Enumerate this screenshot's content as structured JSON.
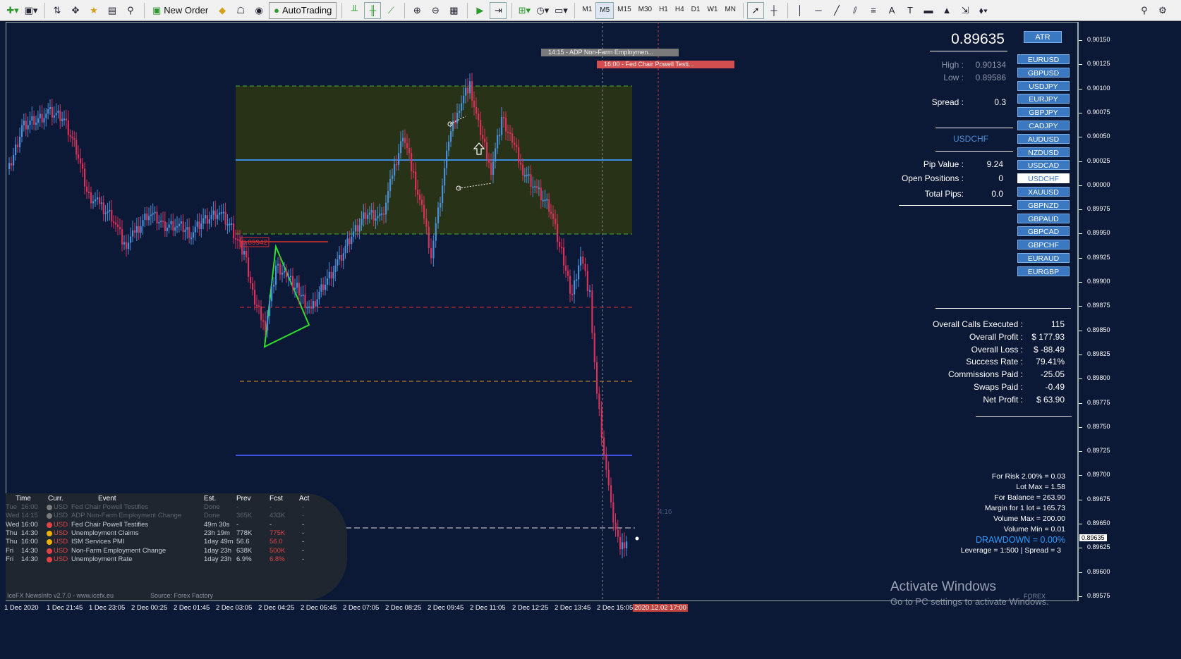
{
  "toolbar": {
    "new_order_label": "New Order",
    "autotrading_label": "AutoTrading",
    "timeframes": [
      "M1",
      "M5",
      "M15",
      "M30",
      "H1",
      "H4",
      "D1",
      "W1",
      "MN"
    ],
    "active_timeframe": "M5"
  },
  "chart": {
    "symbol": "USDCHF",
    "current_price_label": "0.89635",
    "pattern_price_label": "0.89942",
    "price_axis": [
      "0.90150",
      "0.90125",
      "0.90100",
      "0.90075",
      "0.90050",
      "0.90025",
      "0.90000",
      "0.89975",
      "0.89950",
      "0.89925",
      "0.89900",
      "0.89875",
      "0.89850",
      "0.89825",
      "0.89800",
      "0.89775",
      "0.89750",
      "0.89725",
      "0.89700",
      "0.89675",
      "0.89650",
      "0.89625",
      "0.89600",
      "0.89575"
    ],
    "time_axis": [
      "1 Dec 2020",
      "1 Dec 21:45",
      "1 Dec 23:05",
      "2 Dec 00:25",
      "2 Dec 01:45",
      "2 Dec 03:05",
      "2 Dec 04:25",
      "2 Dec 05:45",
      "2 Dec 07:05",
      "2 Dec 08:25",
      "2 Dec 09:45",
      "2 Dec 11:05",
      "2 Dec 12:25",
      "2 Dec 13:45",
      "2 Dec 15:05"
    ],
    "time_highlight": "2020.12.02 17:00",
    "session_label": "4:16",
    "news_markers": [
      {
        "text": "14:15 - ADP Non-Farm Employmen...",
        "color": "#7a7a7a"
      },
      {
        "text": "16:00 - Fed Chair Powell Testi...",
        "color": "#d34f4f"
      }
    ]
  },
  "news_panel": {
    "headers": [
      "Time",
      "Curr.",
      "Event",
      "Est.",
      "Prev",
      "Fcst",
      "Act"
    ],
    "rows": [
      {
        "day": "Tue",
        "time": "16:00",
        "dot": "#7a7a7a",
        "curr": "USD",
        "event": "Fed Chair Powell Testifies",
        "est": "Done",
        "prev": "-",
        "fcst": "-",
        "act": "-",
        "dim": true
      },
      {
        "day": "Wed",
        "time": "14:15",
        "dot": "#7a7a7a",
        "curr": "USD",
        "event": "ADP Non-Farm Employment Change",
        "est": "Done",
        "prev": "365K",
        "fcst": "433K",
        "act": "-",
        "dim": true
      },
      {
        "day": "Wed",
        "time": "16:00",
        "dot": "#e04545",
        "curr": "USD",
        "event": "Fed Chair Powell Testifies",
        "est": "49m 30s",
        "prev": "-",
        "fcst": "-",
        "act": "-",
        "dim": false
      },
      {
        "day": "Thu",
        "time": "14:30",
        "dot": "#f0b000",
        "curr": "USD",
        "event": "Unemployment Claims",
        "est": "23h 19m",
        "prev": "778K",
        "fcst": "775K",
        "act": "-",
        "dim": false,
        "fcst_red": true
      },
      {
        "day": "Thu",
        "time": "16:00",
        "dot": "#f0b000",
        "curr": "USD",
        "event": "ISM Services PMI",
        "est": "1day 49m",
        "prev": "56.6",
        "fcst": "56.0",
        "act": "-",
        "dim": false,
        "fcst_red": true
      },
      {
        "day": "Fri",
        "time": "14:30",
        "dot": "#e04545",
        "curr": "USD",
        "event": "Non-Farm Employment Change",
        "est": "1day 23h",
        "prev": "638K",
        "fcst": "500K",
        "act": "-",
        "dim": false,
        "fcst_red": true
      },
      {
        "day": "Fri",
        "time": "14:30",
        "dot": "#e04545",
        "curr": "USD",
        "event": "Unemployment Rate",
        "est": "1day 23h",
        "prev": "6.9%",
        "fcst": "6.8%",
        "act": "-",
        "dim": false,
        "fcst_red": true
      }
    ],
    "footer": "IceFX NewsInfo v2.7.0  -  www.icefx.eu",
    "source": "Source: Forex Factory"
  },
  "info_panel": {
    "bid": "0.89635",
    "atr_label": "ATR",
    "high_label": "High :",
    "high_value": "0.90134",
    "low_label": "Low :",
    "low_value": "0.89586",
    "spread_label": "Spread :",
    "spread_value": "0.3",
    "symbol": "USDCHF",
    "pip_value_label": "Pip Value :",
    "pip_value": "9.24",
    "open_positions_label": "Open Positions :",
    "open_positions": "0",
    "total_pips_label": "Total Pips:",
    "total_pips": "0.0",
    "symbols": [
      "EURUSD",
      "GBPUSD",
      "USDJPY",
      "EURJPY",
      "GBPJPY",
      "CADJPY",
      "AUDUSD",
      "NZDUSD",
      "USDCAD",
      "USDCHF",
      "XAUUSD",
      "GBPNZD",
      "GBPAUD",
      "GBPCAD",
      "GBPCHF",
      "EURAUD",
      "EURGBP"
    ],
    "active_symbol": "USDCHF",
    "stats": [
      {
        "label": "Overall Calls Executed :",
        "value": "115"
      },
      {
        "label": "Overall Profit :",
        "value": "$ 177.93"
      },
      {
        "label": "Overall Loss :",
        "value": "$ -88.49"
      },
      {
        "label": "Success Rate :",
        "value": "79.41%"
      },
      {
        "label": "Commissions Paid :",
        "value": "-25.05"
      },
      {
        "label": "Swaps Paid :",
        "value": "-0.49"
      },
      {
        "label": "Net Profit :",
        "value": "$ 63.90"
      }
    ],
    "risk_lines": [
      "For Risk 2.00% = 0.03",
      "Lot Max = 1.58",
      "For Balance = 263.90",
      "Margin for 1 lot = 165.73",
      "Volume Max = 200.00",
      "Volume Min = 0.01"
    ],
    "drawdown": "DRAWDOWN =  0.00%",
    "leverage": "Leverage = 1:500 | Spread = 3"
  },
  "watermark": {
    "title": "Activate Windows",
    "subtitle": "Go to PC settings to activate Windows.",
    "broker": "FOREX"
  },
  "colors": {
    "background": "#0b1836",
    "bull_candle": "#4a90d9",
    "bear_candle": "#d9315a",
    "zone": "#2b3513",
    "accent": "#3a78c2"
  }
}
